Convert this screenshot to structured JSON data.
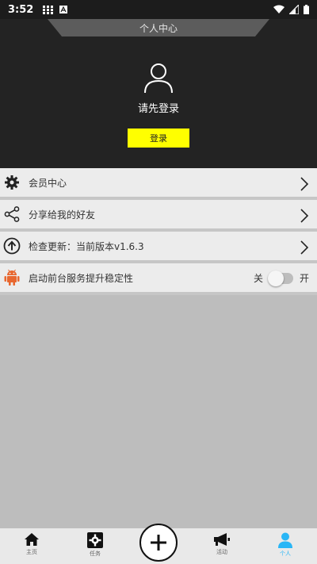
{
  "status_bar": {
    "time": "3:52",
    "notification_icons": [
      "grid-icon",
      "a-icon"
    ],
    "system_icons": [
      "wifi-icon",
      "signal-icon",
      "battery-icon"
    ]
  },
  "header": {
    "title": "个人中心",
    "login_prompt": "请先登录",
    "login_button": "登录",
    "background_color": "#232323",
    "button_color": "#ffff00"
  },
  "menu": {
    "items": [
      {
        "label": "会员中心",
        "icon": "gear-icon"
      },
      {
        "label": "分享给我的好友",
        "icon": "share-icon"
      },
      {
        "label": "检查更新：当前版本v1.6.3",
        "icon": "upload-circle-icon"
      },
      {
        "label": "启动前台服务提升稳定性",
        "icon": "android-icon"
      }
    ],
    "toggle": {
      "off_label": "关",
      "on_label": "开",
      "state": "off"
    }
  },
  "bottom_nav": {
    "items": [
      {
        "label": "主页",
        "icon": "home-icon"
      },
      {
        "label": "任务",
        "icon": "task-gear-icon"
      },
      {
        "label": "",
        "icon": "plus-icon"
      },
      {
        "label": "活动",
        "icon": "megaphone-icon"
      },
      {
        "label": "个人",
        "icon": "person-icon",
        "active": true
      }
    ],
    "active_color": "#29b6f6"
  }
}
